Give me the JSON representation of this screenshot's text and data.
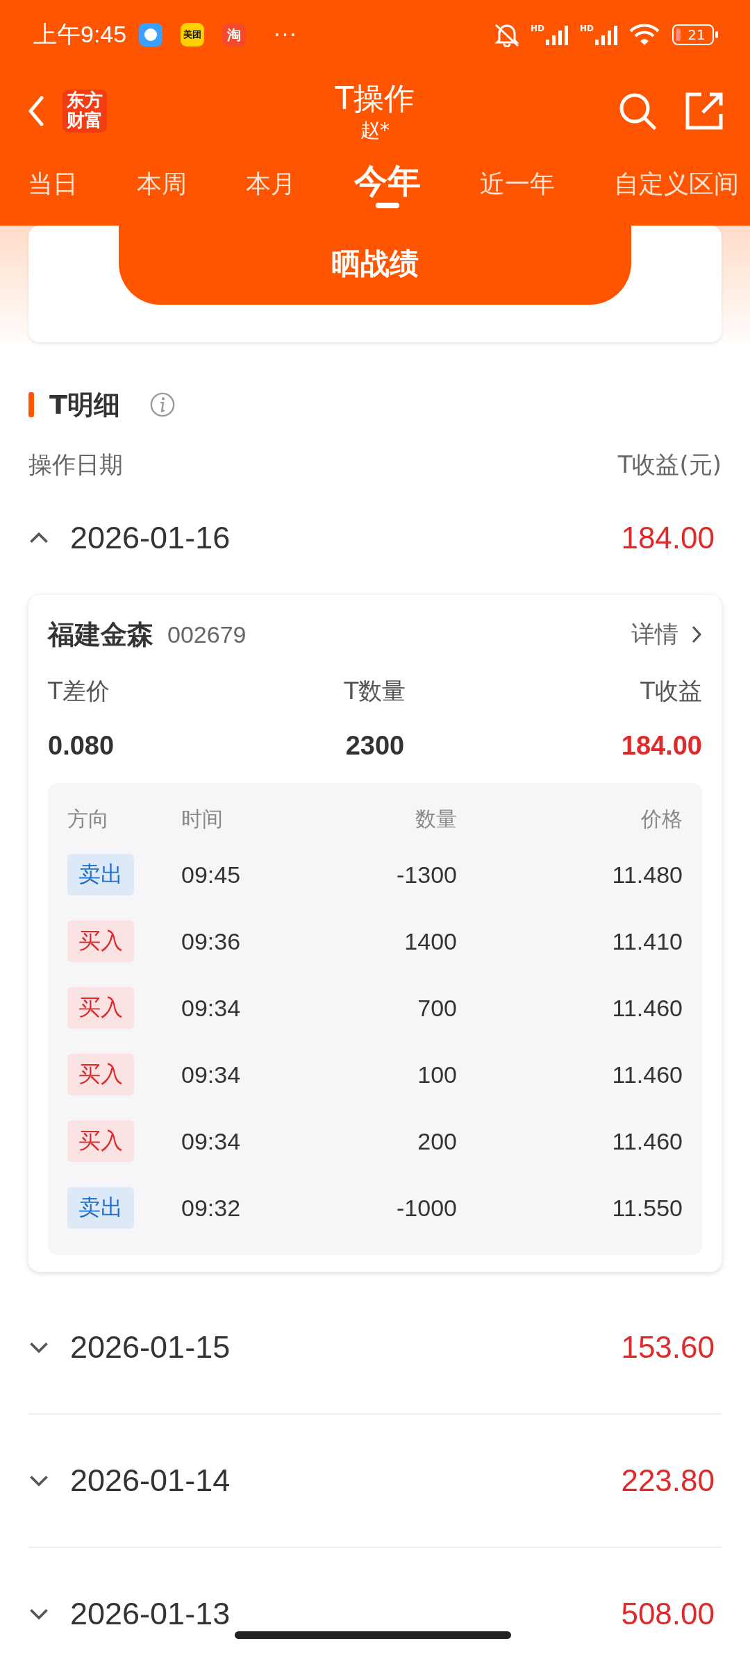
{
  "status_bar": {
    "time": "上午9:45",
    "apps": [
      {
        "kind": "chat"
      },
      {
        "kind": "meituan",
        "label": "美团"
      },
      {
        "kind": "taobao",
        "label": "淘"
      }
    ],
    "more": "···",
    "signals": [
      {
        "label": "HD"
      },
      {
        "label": "HD"
      }
    ],
    "battery": "21"
  },
  "header": {
    "logo": "东方财富",
    "title": "T操作",
    "subtitle": "赵*"
  },
  "tabs": [
    {
      "label": "当日",
      "selected": false
    },
    {
      "label": "本周",
      "selected": false
    },
    {
      "label": "本月",
      "selected": false
    },
    {
      "label": "今年",
      "selected": true
    },
    {
      "label": "近一年",
      "selected": false
    },
    {
      "label": "自定义区间",
      "selected": false
    }
  ],
  "share_button": "晒战绩",
  "section": {
    "title": "T明细"
  },
  "columns": [
    "操作日期",
    "T收益(元)"
  ],
  "days": [
    {
      "date": "2026-01-16",
      "profit": "184.00",
      "expanded": true,
      "detail": {
        "name": "福建金森",
        "code": "002679",
        "link": "详情",
        "metrics": [
          {
            "label": "T差价",
            "value": "0.080",
            "highlight": false
          },
          {
            "label": "T数量",
            "value": "2300",
            "highlight": false
          },
          {
            "label": "T收益",
            "value": "184.00",
            "highlight": true
          }
        ],
        "trade_columns": [
          "方向",
          "时间",
          "数量",
          "价格"
        ],
        "trades": [
          {
            "kind": "sell",
            "label": "卖出",
            "time": "09:45",
            "quantity": "-1300",
            "price": "11.480"
          },
          {
            "kind": "buy",
            "label": "买入",
            "time": "09:36",
            "quantity": "1400",
            "price": "11.410"
          },
          {
            "kind": "buy",
            "label": "买入",
            "time": "09:34",
            "quantity": "700",
            "price": "11.460"
          },
          {
            "kind": "buy",
            "label": "买入",
            "time": "09:34",
            "quantity": "100",
            "price": "11.460"
          },
          {
            "kind": "buy",
            "label": "买入",
            "time": "09:34",
            "quantity": "200",
            "price": "11.460"
          },
          {
            "kind": "sell",
            "label": "卖出",
            "time": "09:32",
            "quantity": "-1000",
            "price": "11.550"
          }
        ]
      }
    },
    {
      "date": "2026-01-15",
      "profit": "153.60",
      "expanded": false
    },
    {
      "date": "2026-01-14",
      "profit": "223.80",
      "expanded": false
    },
    {
      "date": "2026-01-13",
      "profit": "508.00",
      "expanded": false
    }
  ]
}
